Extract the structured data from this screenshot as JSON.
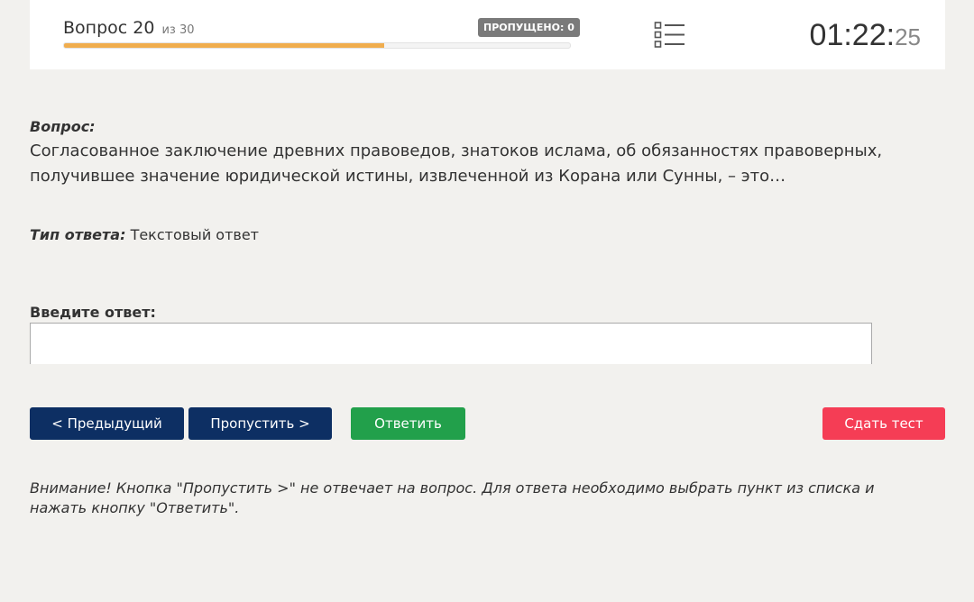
{
  "header": {
    "question_label": "Вопрос 20",
    "question_of": "из 30",
    "skipped_badge": "ПРОПУЩЕНО: 0",
    "progress_fraction": 0.633,
    "progress_color": "#f0ad4e",
    "list_icon": "question-list-icon",
    "timer_main": "01:22:",
    "timer_seconds": "25"
  },
  "question": {
    "label": "Вопрос:",
    "text": "Согласованное заключение древних правоведов, знатоков ислама, об обязанностях правоверных, получившее значение юридической истины, извлеченной из Корана или Сунны, – это…"
  },
  "answer_type": {
    "label": "Тип ответа:",
    "value": "Текстовый ответ"
  },
  "answer_input": {
    "label": "Введите ответ:",
    "value": "",
    "placeholder": ""
  },
  "buttons": {
    "prev": "< Предыдущий",
    "skip": "Пропустить >",
    "answer": "Ответить",
    "submit": "Сдать тест"
  },
  "colors": {
    "nav_button": "#0d2f63",
    "answer_button": "#22a04b",
    "submit_button": "#f53d55",
    "background": "#f2f1ee"
  },
  "notice": "Внимание! Кнопка \"Пропустить >\" не отвечает на вопрос. Для ответа необходимо выбрать пункт из списка и нажать кнопку \"Ответить\"."
}
